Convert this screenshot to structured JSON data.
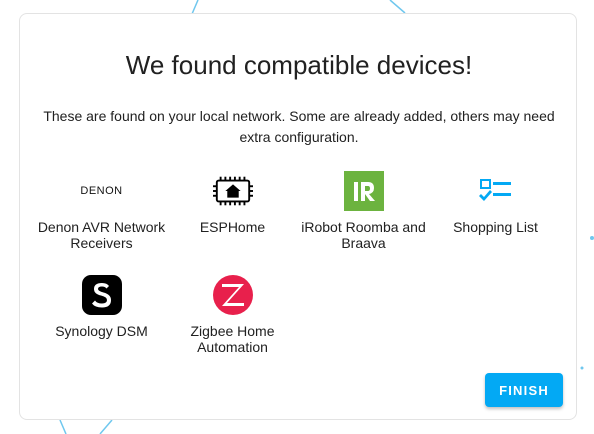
{
  "dialog": {
    "title": "We found compatible devices!",
    "subtitle": "These are found on your local network. Some are already added, others may need extra configuration.",
    "finish_label": "FINISH",
    "accent_color": "#03a9f4"
  },
  "devices": [
    {
      "label": "Denon AVR Network Receivers",
      "icon": "denon-logo",
      "logo_text": "DENON"
    },
    {
      "label": "ESPHome",
      "icon": "esphome-logo"
    },
    {
      "label": "iRobot Roomba and Braava",
      "icon": "irobot-logo"
    },
    {
      "label": "Shopping List",
      "icon": "shopping-list-icon",
      "color": "#03a9f4"
    },
    {
      "label": "Synology DSM",
      "icon": "synology-logo"
    },
    {
      "label": "Zigbee Home Automation",
      "icon": "zigbee-logo",
      "color": "#e8204c"
    }
  ]
}
